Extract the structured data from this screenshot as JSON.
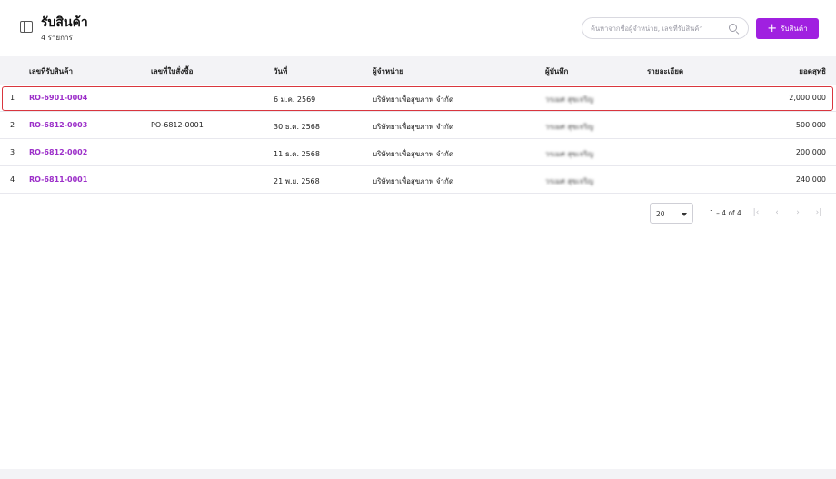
{
  "header": {
    "title": "รับสินค้า",
    "subtitle": "4 รายการ",
    "search_placeholder": "ค้นหาจากชื่อผู้จำหน่าย, เลขที่รับสินค้า",
    "add_label": "รับสินค้า"
  },
  "table": {
    "columns": [
      "เลขที่รับสินค้า",
      "เลขที่ใบสั่งซื้อ",
      "วันที่",
      "ผู้จำหน่าย",
      "ผู้บันทึก",
      "รายละเอียด",
      "ยอดสุทธิ"
    ],
    "rows": [
      {
        "index": "1",
        "receipt_no": "RO-6901-0004",
        "po_no": "",
        "date": "6 ม.ค. 2569",
        "vendor": "บริษัทยาเพื่อสุขภาพ จำกัด",
        "recorder": "วรเมศ สุขเจริญ",
        "detail": "",
        "total": "2,000.000"
      },
      {
        "index": "2",
        "receipt_no": "RO-6812-0003",
        "po_no": "PO-6812-0001",
        "date": "30 ธ.ค. 2568",
        "vendor": "บริษัทยาเพื่อสุขภาพ จำกัด",
        "recorder": "วรเมศ สุขเจริญ",
        "detail": "",
        "total": "500.000"
      },
      {
        "index": "3",
        "receipt_no": "RO-6812-0002",
        "po_no": "",
        "date": "11 ธ.ค. 2568",
        "vendor": "บริษัทยาเพื่อสุขภาพ จำกัด",
        "recorder": "วรเมศ สุขเจริญ",
        "detail": "",
        "total": "200.000"
      },
      {
        "index": "4",
        "receipt_no": "RO-6811-0001",
        "po_no": "",
        "date": "21 พ.ย. 2568",
        "vendor": "บริษัทยาเพื่อสุขภาพ จำกัด",
        "recorder": "วรเมศ สุขเจริญ",
        "detail": "",
        "total": "240.000"
      }
    ]
  },
  "pagination": {
    "page_size": "20",
    "range": "1 – 4 of 4",
    "first_icon": "first-page-icon",
    "prev_icon": "prev-page-icon",
    "next_icon": "next-page-icon",
    "last_icon": "last-page-icon"
  },
  "colors": {
    "accent": "#a020e0",
    "link": "#9c2fc9",
    "highlight": "#d9363e",
    "header_bg": "#f3f3f6"
  }
}
